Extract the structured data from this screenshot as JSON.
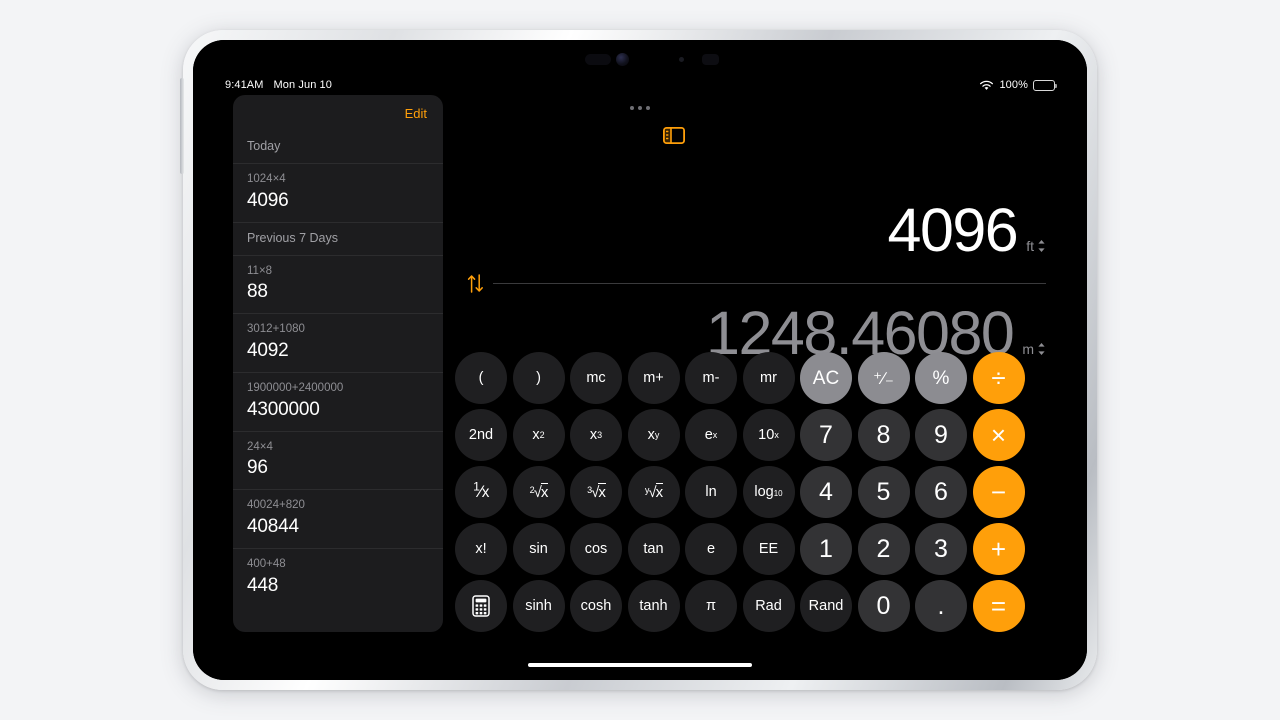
{
  "statusbar": {
    "time": "9:41AM",
    "date": "Mon Jun 10",
    "battery_percent": "100%",
    "wifi_icon": "wifi-icon",
    "battery_icon": "battery-icon"
  },
  "sidebar": {
    "edit_label": "Edit",
    "toggle_icon": "sidebar-toggle-icon",
    "sections": [
      {
        "title": "Today",
        "entries": [
          {
            "expression": "1024×4",
            "result": "4096"
          }
        ]
      },
      {
        "title": "Previous 7 Days",
        "entries": [
          {
            "expression": "11×8",
            "result": "88"
          },
          {
            "expression": "3012+1080",
            "result": "4092"
          },
          {
            "expression": "1900000+2400000",
            "result": "4300000"
          },
          {
            "expression": "24×4",
            "result": "96"
          },
          {
            "expression": "40024+820",
            "result": "40844"
          },
          {
            "expression": "400+48",
            "result": "448"
          }
        ]
      }
    ]
  },
  "display": {
    "primary_value": "4096",
    "primary_unit": "ft",
    "secondary_value": "1248.46080",
    "secondary_unit": "m",
    "swap_icon": "swap-vertical-arrows-icon",
    "unit_chevron_icon": "chevron-up-down-icon"
  },
  "keypad": {
    "rows": [
      [
        {
          "label": "(",
          "kind": "func"
        },
        {
          "label": ")",
          "kind": "func"
        },
        {
          "label": "mc",
          "kind": "func"
        },
        {
          "label": "m+",
          "kind": "func"
        },
        {
          "label": "m-",
          "kind": "func"
        },
        {
          "label": "mr",
          "kind": "func"
        },
        {
          "label": "AC",
          "kind": "util"
        },
        {
          "label": "+/-",
          "kind": "util"
        },
        {
          "label": "%",
          "kind": "util"
        },
        {
          "label": "÷",
          "kind": "op"
        }
      ],
      [
        {
          "label": "2nd",
          "kind": "func"
        },
        {
          "label": "x²",
          "kind": "func"
        },
        {
          "label": "x³",
          "kind": "func"
        },
        {
          "label": "xʸ",
          "kind": "func"
        },
        {
          "label": "eˣ",
          "kind": "func"
        },
        {
          "label": "10ˣ",
          "kind": "func"
        },
        {
          "label": "7",
          "kind": "digit"
        },
        {
          "label": "8",
          "kind": "digit"
        },
        {
          "label": "9",
          "kind": "digit"
        },
        {
          "label": "×",
          "kind": "op"
        }
      ],
      [
        {
          "label": "1/x",
          "kind": "func"
        },
        {
          "label": "²√x",
          "kind": "func"
        },
        {
          "label": "³√x",
          "kind": "func"
        },
        {
          "label": "ʸ√x",
          "kind": "func"
        },
        {
          "label": "ln",
          "kind": "func"
        },
        {
          "label": "log₁₀",
          "kind": "func"
        },
        {
          "label": "4",
          "kind": "digit"
        },
        {
          "label": "5",
          "kind": "digit"
        },
        {
          "label": "6",
          "kind": "digit"
        },
        {
          "label": "−",
          "kind": "op"
        }
      ],
      [
        {
          "label": "x!",
          "kind": "func"
        },
        {
          "label": "sin",
          "kind": "func"
        },
        {
          "label": "cos",
          "kind": "func"
        },
        {
          "label": "tan",
          "kind": "func"
        },
        {
          "label": "e",
          "kind": "func"
        },
        {
          "label": "EE",
          "kind": "func"
        },
        {
          "label": "1",
          "kind": "digit"
        },
        {
          "label": "2",
          "kind": "digit"
        },
        {
          "label": "3",
          "kind": "digit"
        },
        {
          "label": "+",
          "kind": "op"
        }
      ],
      [
        {
          "label": "calculator-icon",
          "kind": "func"
        },
        {
          "label": "sinh",
          "kind": "func"
        },
        {
          "label": "cosh",
          "kind": "func"
        },
        {
          "label": "tanh",
          "kind": "func"
        },
        {
          "label": "π",
          "kind": "func"
        },
        {
          "label": "Rad",
          "kind": "func"
        },
        {
          "label": "Rand",
          "kind": "func"
        },
        {
          "label": "0",
          "kind": "digit"
        },
        {
          "label": ".",
          "kind": "digit"
        },
        {
          "label": "=",
          "kind": "op"
        }
      ]
    ]
  },
  "colors": {
    "accent_orange": "#ff9f0a",
    "util_gray": "#8c8c91",
    "digit_gray": "#333335",
    "func_gray": "#1f1f21",
    "sidebar_bg": "#1c1c1e",
    "screen_bg": "#000000",
    "page_bg": "#f3f4f6"
  }
}
